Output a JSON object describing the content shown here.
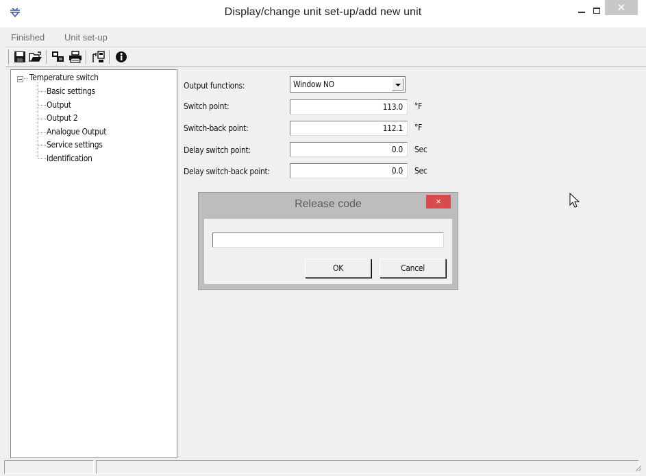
{
  "window": {
    "title": "Display/change unit set-up/add new unit",
    "close_glyph": "✕"
  },
  "menu": {
    "items": [
      "Finished",
      "Unit set-up"
    ]
  },
  "toolbar": {
    "buttons": [
      "save-icon",
      "open-folder-icon",
      "transfer-icon",
      "print-icon",
      "device-connect-icon",
      "info-icon"
    ]
  },
  "tree": {
    "root": "Temperature switch",
    "children": [
      "Basic settings",
      "Output",
      "Output 2",
      "Analogue Output",
      "Service settings",
      "Identification"
    ],
    "selected": "Output"
  },
  "form": {
    "output_functions": {
      "label": "Output functions:",
      "value": "Window NO"
    },
    "switch_point": {
      "label": "Switch point:",
      "value": "113.0",
      "unit": "°F"
    },
    "switch_back_point": {
      "label": "Switch-back point:",
      "value": "112.1",
      "unit": "°F"
    },
    "delay_switch_point": {
      "label": "Delay switch point:",
      "value": "0.0",
      "unit": "Sec"
    },
    "delay_switch_back_point": {
      "label": "Delay switch-back point:",
      "value": "0.0",
      "unit": "Sec"
    }
  },
  "dialog": {
    "title": "Release code",
    "close_glyph": "×",
    "input_value": "",
    "ok_label": "OK",
    "cancel_label": "Cancel"
  },
  "colors": {
    "dialog_close": "#d94a4a",
    "window_close": "#c7c7c7",
    "app_icon": "#3a55a8"
  }
}
